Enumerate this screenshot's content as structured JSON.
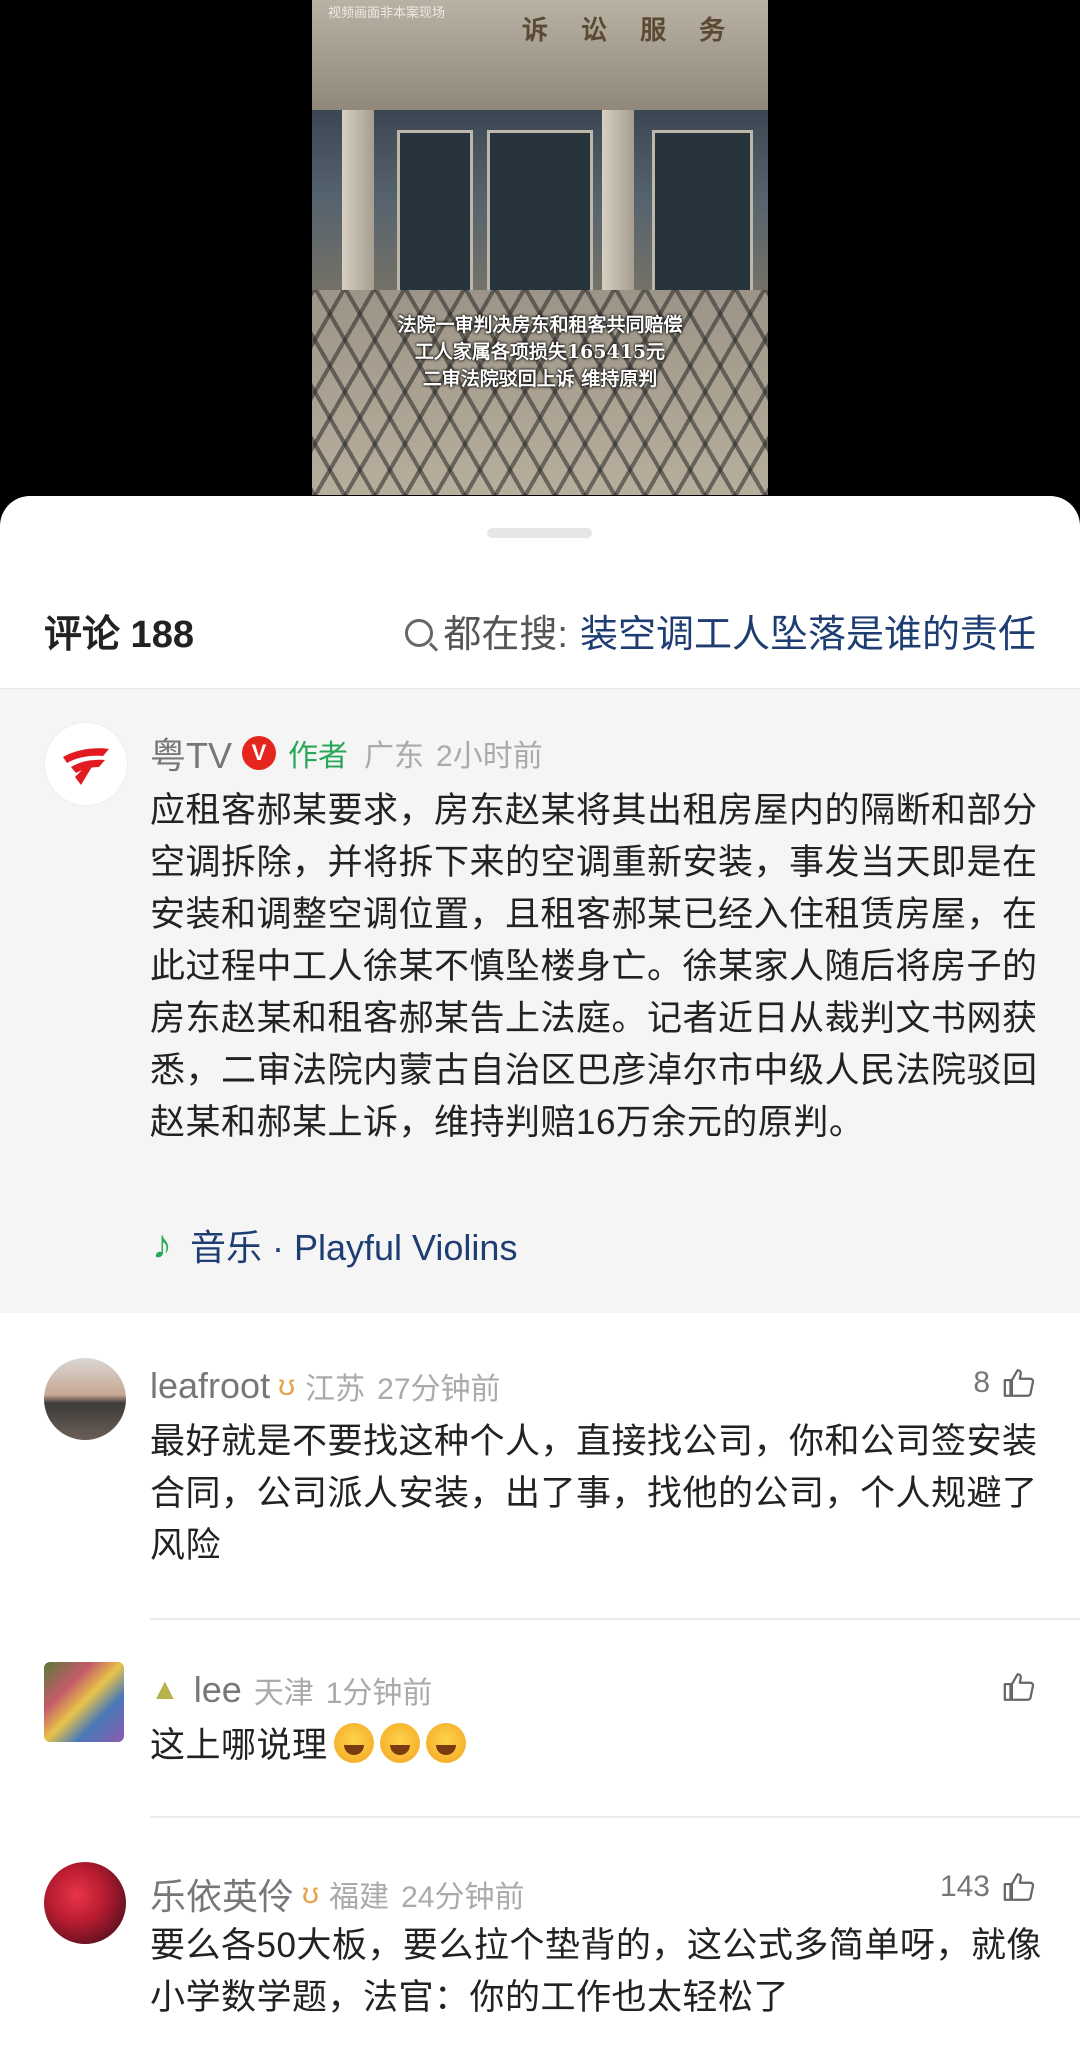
{
  "video": {
    "watermark": "视频画面非本案现场",
    "sign_text": "诉 讼 服 务",
    "caption_lines": [
      "法院一审判决房东和租客共同赔偿",
      "工人家属各项损失165415元",
      "二审法院驳回上诉 维持原判"
    ]
  },
  "header": {
    "comments_label": "评论 188",
    "search_prefix": "都在搜:",
    "search_term": "装空调工人坠落是谁的责任"
  },
  "author_post": {
    "name": "粤TV",
    "verified_badge": "V",
    "tag": "作者",
    "location": "广东",
    "time": "2小时前",
    "text": "应租客郝某要求，房东赵某将其出租房屋内的隔断和部分空调拆除，并将拆下来的空调重新安装，事发当天即是在安装和调整空调位置，且租客郝某已经入住租赁房屋，在此过程中工人徐某不慎坠楼身亡。徐某家人随后将房子的房东赵某和租客郝某告上法庭。记者近日从裁判文书网获悉，二审法院内蒙古自治区巴彦淖尔市中级人民法院驳回赵某和郝某上诉，维持判赔16万余元的原判。",
    "music": "音乐 · Playful Violins"
  },
  "comments": [
    {
      "name": "leafroot",
      "badge": "ʊ",
      "location": "江苏",
      "time": "27分钟前",
      "likes": "8",
      "text": "最好就是不要找这种个人，直接找公司，你和公司签安装合同，公司派人安装，出了事，找他的公司，个人规避了风险"
    },
    {
      "name": "lee",
      "location": "天津",
      "time": "1分钟前",
      "likes": "",
      "text": "这上哪说理"
    },
    {
      "name": "乐依英伶",
      "badge": "ʊ",
      "location": "福建",
      "time": "24分钟前",
      "likes": "143",
      "text": "要么各50大板，要么拉个垫背的，这公式多简单呀，就像小学数学题，法官：你的工作也太轻松了"
    }
  ],
  "colors": {
    "accent_link": "#1e3d72",
    "author_tag": "#2aa85a",
    "verified": "#e5261e"
  }
}
